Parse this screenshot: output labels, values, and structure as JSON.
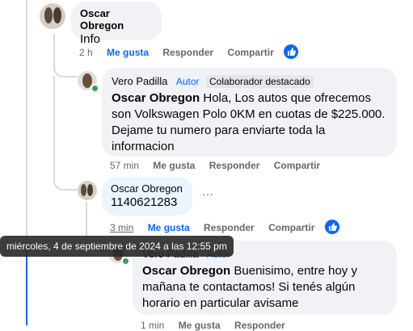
{
  "comments": [
    {
      "author": "Oscar Obregon",
      "text": "Info",
      "time": "2 h",
      "like_label": "Me gusta",
      "reply_label": "Responder",
      "share_label": "Compartir"
    },
    {
      "author": "Vero Padilla",
      "author_badge": "Autor",
      "top_badge": "Colaborador destacado",
      "mention": "Oscar Obregon",
      "text": "Hola, Los autos que ofrecemos son Volkswagen Polo 0KM en cuotas de $225.000. Dejame tu numero para enviarte toda la informacion",
      "time": "57 min",
      "like_label": "Me gusta",
      "reply_label": "Responder",
      "share_label": "Compartir"
    },
    {
      "author": "Oscar Obregon",
      "text": "1140621283",
      "more": "···",
      "time": "3 min",
      "like_label": "Me gusta",
      "reply_label": "Responder",
      "share_label": "Compartir"
    },
    {
      "author": "Vero Padilla",
      "author_badge": "Autor",
      "mention": "Oscar Obregon",
      "text": "Buenisimo, entre hoy y mañana te contactamos! Si tenés algún horario en particular avisame",
      "time": "1 min",
      "like_label": "Me gusta",
      "reply_label": "Responder"
    }
  ],
  "tooltip": "miércoles, 4 de septiembre de 2024 a las 12:55 pm",
  "colors": {
    "accent": "#0866ff",
    "bubble": "#f0f2f5",
    "online": "#31a24c"
  }
}
